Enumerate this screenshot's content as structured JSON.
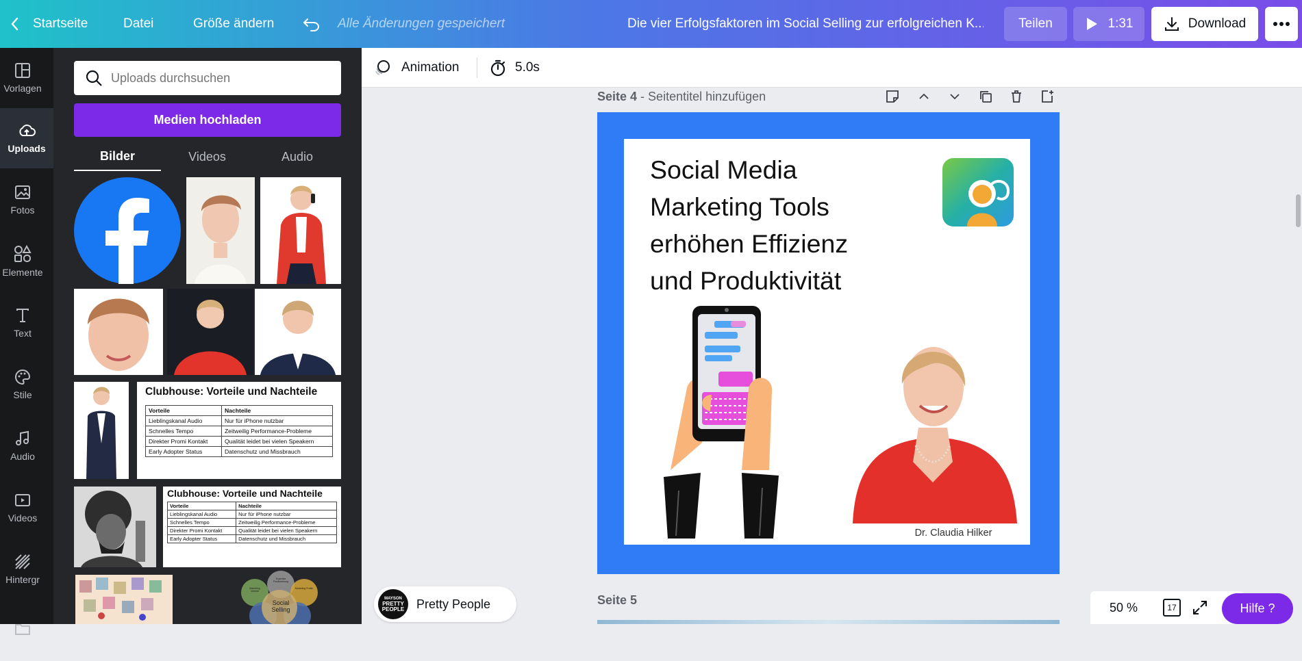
{
  "topbar": {
    "home": "Startseite",
    "file": "Datei",
    "resize": "Größe ändern",
    "saved": "Alle Änderungen gespeichert",
    "title": "Die vier Erfolgsfaktoren im Social Selling zur erfolgreichen K...",
    "share": "Teilen",
    "duration": "1:31",
    "download": "Download"
  },
  "rail": [
    {
      "label": "Vorlagen",
      "icon": "templates-icon"
    },
    {
      "label": "Uploads",
      "icon": "upload-cloud-icon"
    },
    {
      "label": "Fotos",
      "icon": "photos-icon"
    },
    {
      "label": "Elemente",
      "icon": "elements-icon"
    },
    {
      "label": "Text",
      "icon": "text-icon"
    },
    {
      "label": "Stile",
      "icon": "palette-icon"
    },
    {
      "label": "Audio",
      "icon": "music-icon"
    },
    {
      "label": "Videos",
      "icon": "video-icon"
    },
    {
      "label": "Hintergr",
      "icon": "background-icon"
    }
  ],
  "panel": {
    "search_placeholder": "Uploads durchsuchen",
    "upload_button": "Medien hochladen",
    "tabs": [
      "Bilder",
      "Videos",
      "Audio"
    ],
    "table_title": "Clubhouse: Vorteile und Nachteile",
    "table_headers": [
      "Vorteile",
      "Nachteile"
    ],
    "table_rows": [
      [
        "Lieblingskanal Audio",
        "Nur für iPhone nutzbar"
      ],
      [
        "Schnelles Tempo",
        "Zeitweilig Performance-Probleme"
      ],
      [
        "Direkter Promi Kontakt",
        "Qualität leidet bei vielen Speakern"
      ],
      [
        "Early Adopter Status",
        "Datenschutz und Missbrauch"
      ]
    ],
    "venn_center": "Social Selling",
    "venn_labels": [
      "Expertise Positionierung",
      "Marketing Vertrieb",
      "Marketing Profile"
    ]
  },
  "toolbar": {
    "animation": "Animation",
    "timer": "5.0s"
  },
  "page4": {
    "label": "Seite 4",
    "subtitle": "Seitentitel hinzufügen",
    "heading_lines": [
      "Social Media",
      "Marketing Tools",
      "erhöhen Effizienz",
      "und Produktivität"
    ],
    "credit": "Dr. Claudia Hilker"
  },
  "page5": {
    "label": "Seite 5"
  },
  "footer": {
    "account_name": "Pretty People",
    "logo_text_top": "MAYSON",
    "logo_text_main": "PRETTY PEOPLE",
    "zoom": "50 %",
    "page_count": "17",
    "help": "Hilfe ?"
  },
  "colors": {
    "accent": "#7d2ae8",
    "page_frame": "#2f7cf6",
    "topbar_start": "#1fc2c9",
    "topbar_end": "#7a4de8"
  }
}
